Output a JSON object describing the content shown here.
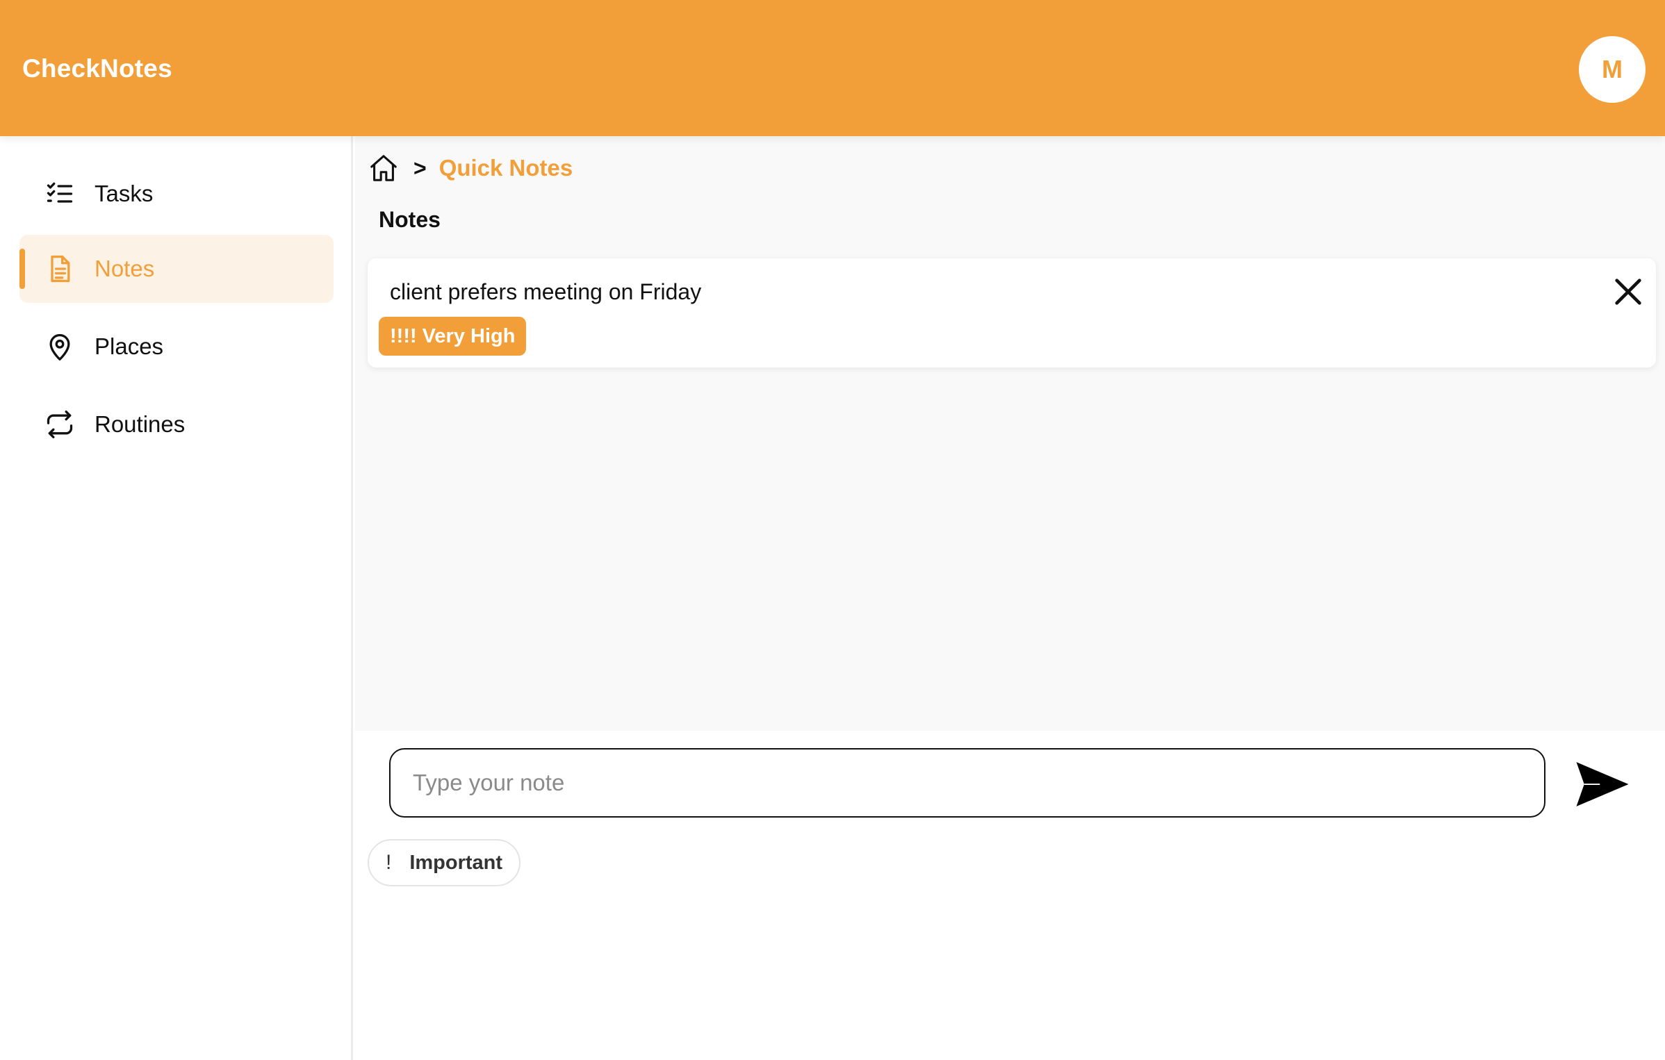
{
  "header": {
    "app_title": "CheckNotes",
    "avatar_initial": "M",
    "brand_color": "#f29f39"
  },
  "sidebar": {
    "items": [
      {
        "label": "Tasks",
        "icon": "checklist-icon",
        "active": false
      },
      {
        "label": "Notes",
        "icon": "document-icon",
        "active": true
      },
      {
        "label": "Places",
        "icon": "map-pin-icon",
        "active": false
      },
      {
        "label": "Routines",
        "icon": "repeat-icon",
        "active": false
      }
    ]
  },
  "breadcrumb": {
    "home_icon": "home-icon",
    "separator": ">",
    "current": "Quick Notes"
  },
  "main": {
    "section_title": "Notes",
    "notes": [
      {
        "text": "client prefers meeting on Friday",
        "priority": "!!!! Very High"
      }
    ]
  },
  "composer": {
    "placeholder": "Type your note",
    "value": "",
    "send_icon": "send-icon",
    "chip": {
      "icon": "!",
      "label": "Important"
    }
  }
}
